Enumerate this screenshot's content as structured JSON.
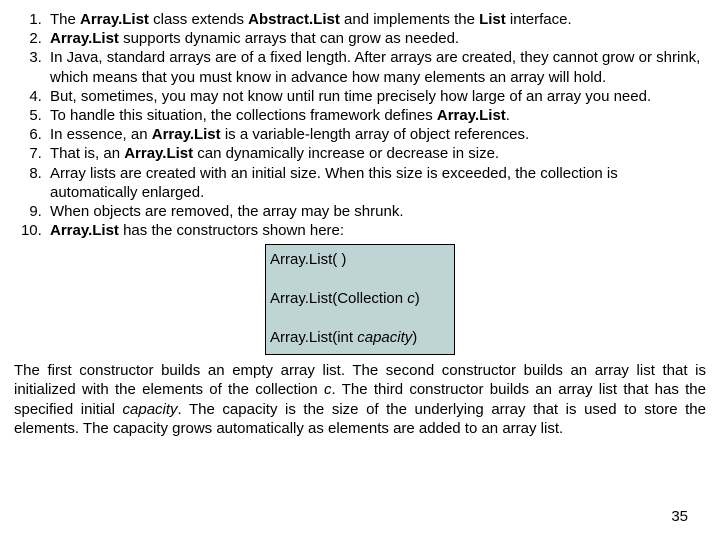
{
  "list": {
    "item1": {
      "a": "The ",
      "b": "Array.List",
      "c": " class extends ",
      "d": "Abstract.List",
      "e": " and implements the ",
      "f": "List",
      "g": " interface."
    },
    "item2": {
      "a": "Array.List",
      "b": " supports dynamic arrays that can grow as needed."
    },
    "item3": "In Java, standard arrays are of a fixed length. After arrays are created, they cannot grow or shrink, which means that you must know in advance how many elements an array will hold.",
    "item4": "But, sometimes, you may not know until run time precisely how large of an array you need.",
    "item5": {
      "a": "To handle this situation, the collections framework defines ",
      "b": "Array.List",
      "c": "."
    },
    "item6": {
      "a": "In essence, an ",
      "b": "Array.List",
      "c": " is a variable-length array of object references."
    },
    "item7": {
      "a": "That is, an ",
      "b": "Array.List",
      "c": " can dynamically increase or decrease in size."
    },
    "item8": "Array lists are created with an initial size. When this size is exceeded, the collection is automatically enlarged.",
    "item9": "When objects are removed, the array may be shrunk.",
    "item10": {
      "a": "Array.List",
      "b": " has the constructors shown here:"
    }
  },
  "ctor": {
    "c1": "Array.List( )",
    "c2a": "Array.List(Collection ",
    "c2b": "c",
    "c2c": ")",
    "c3a": "Array.List(int ",
    "c3b": "capacity",
    "c3c": ")"
  },
  "para": {
    "p1": "The first constructor builds an empty array list. The second constructor builds an array list that is initialized with the elements of the collection ",
    "p1i": "c",
    "p2": ". The third constructor builds an array list that has the specified initial ",
    "p2i": "capacity",
    "p3": ". The capacity is the size of the underlying array that is used to store the elements. The capacity grows automatically as elements are added to an array list."
  },
  "pagenum": "35"
}
